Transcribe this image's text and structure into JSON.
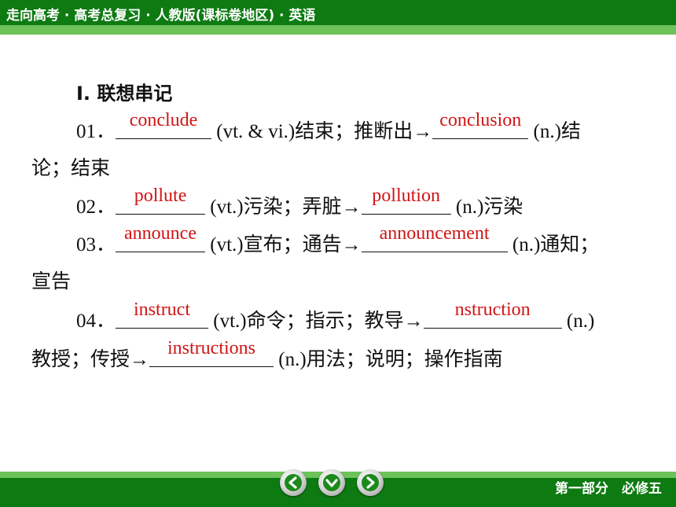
{
  "header": {
    "title": "走向高考 · 高考总复习 · 人教版(课标卷地区) · 英语"
  },
  "content": {
    "heading": "I. 联想串记",
    "items": [
      {
        "num": "01．",
        "answer1": "conclude",
        "mid": "(vt. & vi.)结束；推断出→",
        "answer2": "conclusion",
        "tail": "(n.)结",
        "cont": "论；结束"
      },
      {
        "num": "02．",
        "answer1": "pollute",
        "mid": "(vt.)污染；弄脏→",
        "answer2": "pollution",
        "tail": "(n.)污染"
      },
      {
        "num": "03．",
        "answer1": "announce",
        "mid": "(vt.)宣布；通告→",
        "answer2": "announcement",
        "tail": "(n.)通知；",
        "cont": "宣告"
      },
      {
        "num": "04．",
        "answer1": "instruct",
        "mid": "(vt.)命令；指示；教导→",
        "answer2": "nstruction",
        "tail": "(n.)",
        "cont": "教授；传授→",
        "answer3": "instructions",
        "tail2": "(n.)用法；说明；操作指南"
      }
    ]
  },
  "footer": {
    "label": "第一部分　必修五",
    "nav": [
      "left-arrow-icon",
      "down-arrow-icon",
      "right-arrow-icon"
    ]
  },
  "colors": {
    "header_band": "#0d7a12",
    "stripe": "#6ec25a",
    "answer": "#d01515"
  }
}
